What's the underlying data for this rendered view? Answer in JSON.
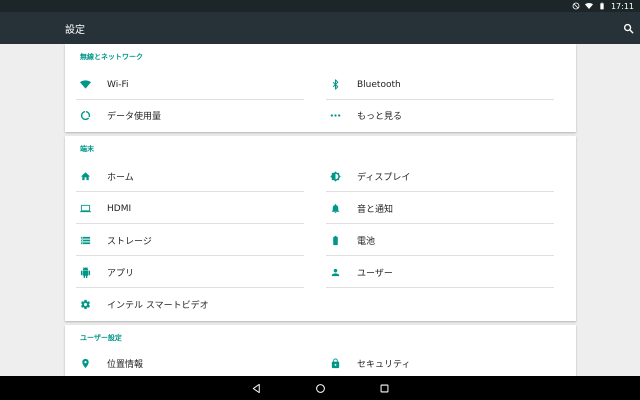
{
  "status": {
    "time": "17:11"
  },
  "appbar": {
    "title": "設定"
  },
  "sections": {
    "wireless": {
      "title": "無線とネットワーク",
      "items": {
        "wifi": "Wi-Fi",
        "bluetooth": "Bluetooth",
        "data_usage": "データ使用量",
        "more": "もっと見る"
      }
    },
    "device": {
      "title": "端末",
      "items": {
        "home": "ホーム",
        "display": "ディスプレイ",
        "hdmi": "HDMI",
        "sound": "音と通知",
        "storage": "ストレージ",
        "battery": "電池",
        "apps": "アプリ",
        "users": "ユーザー",
        "intel_video": "インテル スマートビデオ"
      }
    },
    "personal": {
      "title": "ユーザー設定",
      "items": {
        "location": "位置情報",
        "security": "セキュリティ"
      }
    }
  },
  "colors": {
    "accent": "#009688",
    "appbar": "#263238",
    "statusbar": "#1c2528",
    "background": "#eeeeee",
    "navbar": "#000000"
  },
  "icons": [
    "dnd-icon",
    "wifi-status-icon",
    "battery-status-icon",
    "search-icon",
    "wifi-icon",
    "bluetooth-icon",
    "data-usage-icon",
    "more-icon",
    "home-icon",
    "brightness-icon",
    "laptop-icon",
    "bell-icon",
    "storage-icon",
    "battery-icon",
    "android-icon",
    "person-icon",
    "gear-icon",
    "location-icon",
    "lock-icon",
    "back-icon",
    "home-nav-icon",
    "recents-icon"
  ]
}
